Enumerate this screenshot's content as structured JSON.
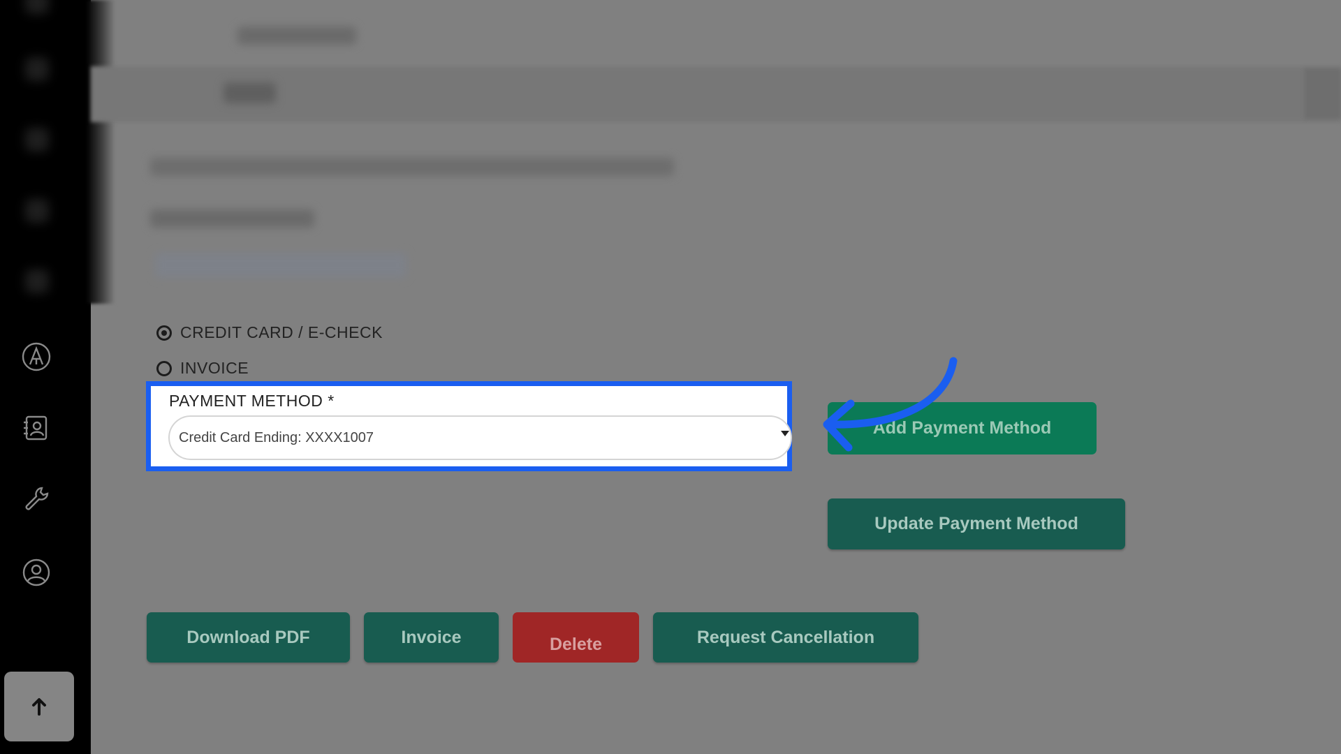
{
  "sidebar": {
    "icons": [
      {
        "name": "letter-a-circle-icon"
      },
      {
        "name": "contacts-book-icon"
      },
      {
        "name": "wrench-icon"
      },
      {
        "name": "user-circle-icon"
      }
    ],
    "scroll_top_icon": "arrow-up-icon"
  },
  "payment_options": {
    "credit_card_label": "CREDIT CARD / E-CHECK",
    "credit_card_selected": true,
    "invoice_label": "INVOICE",
    "invoice_selected": false
  },
  "payment_method": {
    "label": "PAYMENT METHOD *",
    "selected_value": "Credit Card Ending: XXXX1007"
  },
  "actions": {
    "add_payment_method": "Add Payment Method",
    "update_payment_method": "Update Payment Method",
    "download_pdf": "Download PDF",
    "invoice": "Invoice",
    "delete": "Delete",
    "request_cancellation": "Request Cancellation"
  },
  "colors": {
    "highlight": "#1a5ef0",
    "primary_button": "#185c50",
    "add_button": "#0b7a56",
    "delete_button": "#a02626",
    "overlay": "#808080"
  }
}
